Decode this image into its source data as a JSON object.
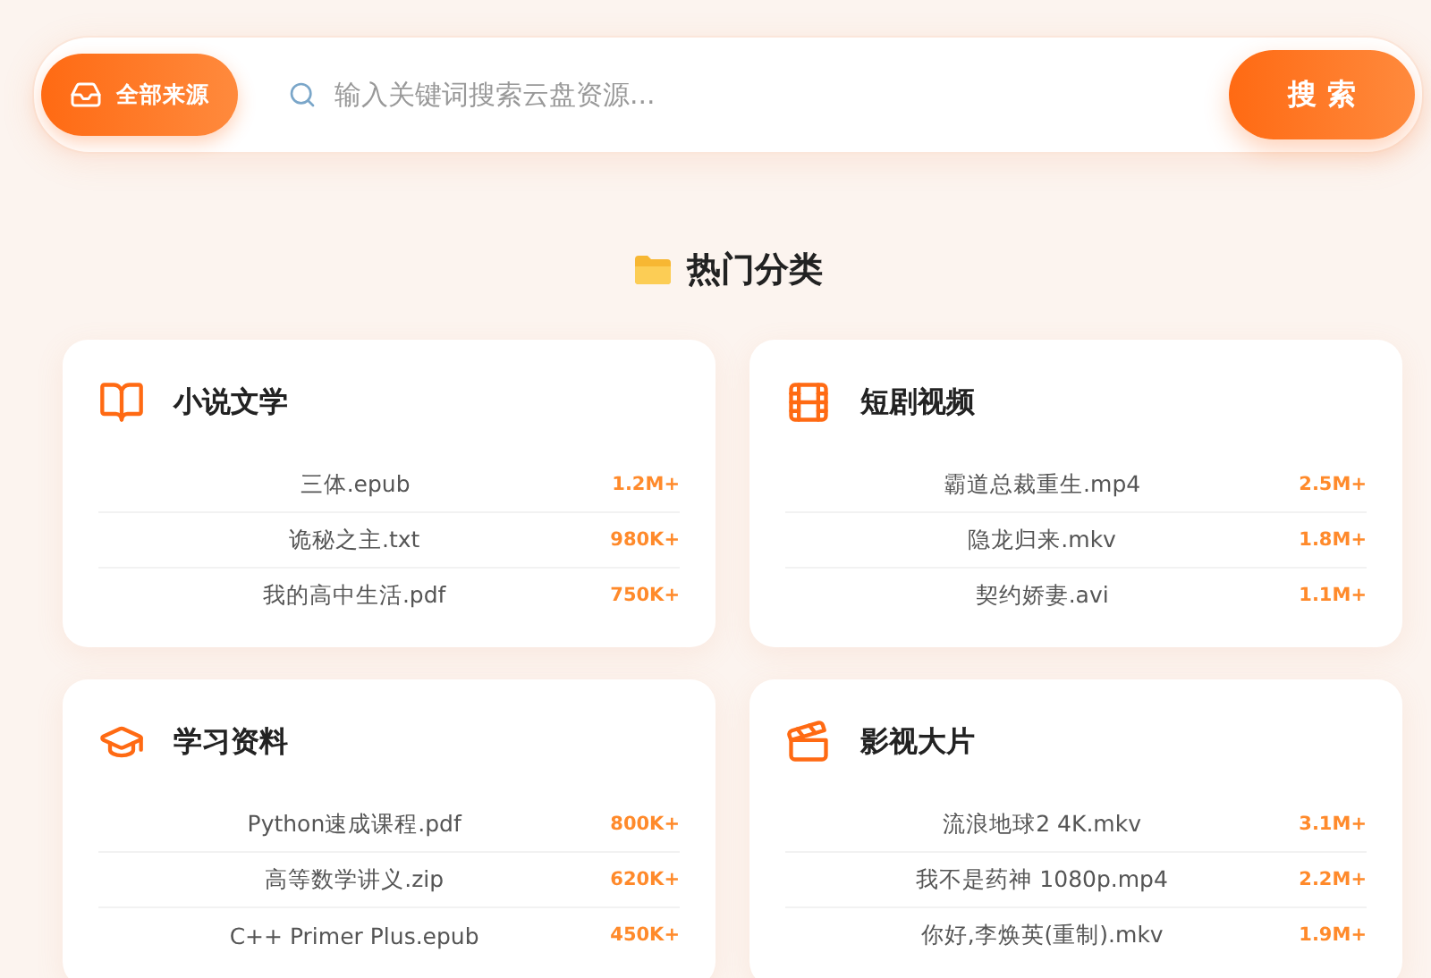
{
  "search_bar": {
    "source_button": "全部来源",
    "placeholder": "输入关键词搜索云盘资源...",
    "search_button": "搜 索"
  },
  "section_title": "热门分类",
  "categories": [
    {
      "title": "小说文学",
      "items": [
        {
          "name": "三体.epub",
          "count": "1.2M+"
        },
        {
          "name": "诡秘之主.txt",
          "count": "980K+"
        },
        {
          "name": "我的高中生活.pdf",
          "count": "750K+"
        }
      ]
    },
    {
      "title": "短剧视频",
      "items": [
        {
          "name": "霸道总裁重生.mp4",
          "count": "2.5M+"
        },
        {
          "name": "隐龙归来.mkv",
          "count": "1.8M+"
        },
        {
          "name": "契约娇妻.avi",
          "count": "1.1M+"
        }
      ]
    },
    {
      "title": "学习资料",
      "items": [
        {
          "name": "Python速成课程.pdf",
          "count": "800K+"
        },
        {
          "name": "高等数学讲义.zip",
          "count": "620K+"
        },
        {
          "name": "C++ Primer Plus.epub",
          "count": "450K+"
        }
      ]
    },
    {
      "title": "影视大片",
      "items": [
        {
          "name": "流浪地球2 4K.mkv",
          "count": "3.1M+"
        },
        {
          "name": "我不是药神 1080p.mp4",
          "count": "2.2M+"
        },
        {
          "name": "你好,李焕英(重制).mkv",
          "count": "1.9M+"
        }
      ]
    }
  ]
}
